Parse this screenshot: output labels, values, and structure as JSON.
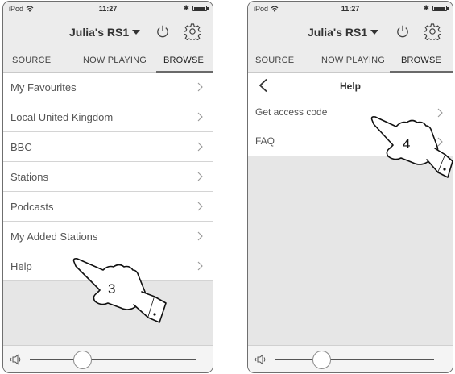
{
  "screens": [
    {
      "status": {
        "carrier": "iPod",
        "time": "11:27"
      },
      "device_name": "Julia's RS1",
      "tabs": [
        "SOURCE",
        "NOW PLAYING",
        "BROWSE"
      ],
      "active_tab": "BROWSE",
      "list": [
        "My Favourites",
        "Local United Kingdom",
        "BBC",
        "Stations",
        "Podcasts",
        "My Added Stations",
        "Help"
      ],
      "callout": "3",
      "volume": 0.28
    },
    {
      "status": {
        "carrier": "iPod",
        "time": "11:27"
      },
      "device_name": "Julia's RS1",
      "tabs": [
        "SOURCE",
        "NOW PLAYING",
        "BROWSE"
      ],
      "active_tab": "BROWSE",
      "subheader_title": "Help",
      "list": [
        "Get access code",
        "FAQ"
      ],
      "callout": "4",
      "volume": 0.28
    }
  ],
  "icons": {
    "wifi": "wifi-icon",
    "bluetooth": "bluetooth-icon",
    "battery": "battery-icon",
    "power": "power-icon",
    "settings": "gear-icon",
    "back": "back-chevron-icon",
    "row_arrow": "chevron-right-icon",
    "volume": "speaker-icon",
    "pointer": "pointing-hand-icon"
  }
}
